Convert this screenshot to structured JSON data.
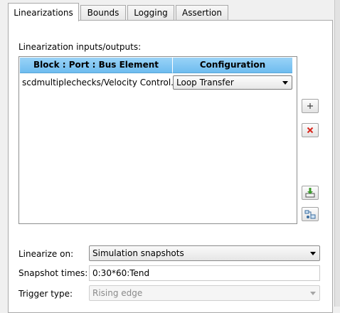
{
  "tabs": [
    {
      "label": "Linearizations"
    },
    {
      "label": "Bounds"
    },
    {
      "label": "Logging"
    },
    {
      "label": "Assertion"
    }
  ],
  "io_section": {
    "title": "Linearization inputs/outputs:",
    "columns": [
      "Block : Port : Bus Element",
      "Configuration"
    ],
    "rows": [
      {
        "block": "scdmultiplechecks/Velocity Control...",
        "configuration": "Loop Transfer"
      }
    ]
  },
  "side_buttons": {
    "add": "add-icon",
    "remove": "delete-icon",
    "import": "import-icon",
    "highlight": "highlight-icon"
  },
  "form": {
    "linearize_on_label": "Linearize on:",
    "linearize_on_value": "Simulation snapshots",
    "snapshot_times_label": "Snapshot times:",
    "snapshot_times_value": "0:30*60:Tend",
    "trigger_type_label": "Trigger type:",
    "trigger_type_value": "Rising edge"
  },
  "colors": {
    "header_blue": "#6ebcef",
    "remove_red": "#d9261c",
    "import_green": "#3a9a2a"
  }
}
